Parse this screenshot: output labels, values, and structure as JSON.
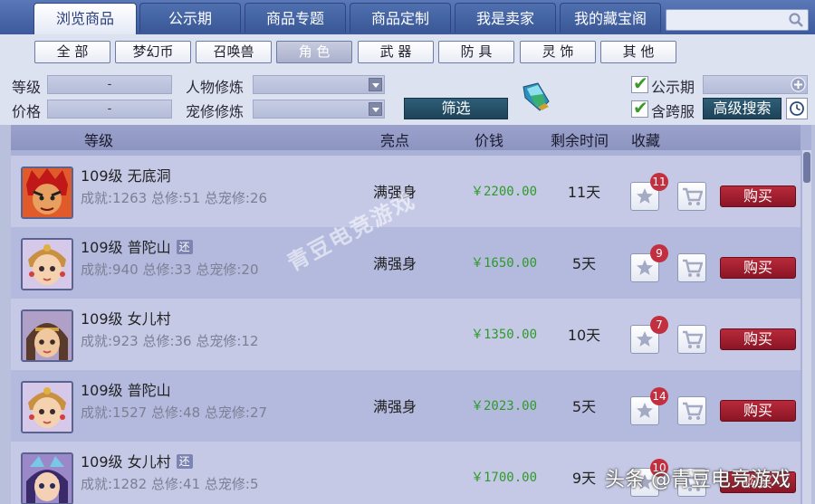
{
  "tabs": [
    "浏览商品",
    "公示期",
    "商品专题",
    "商品定制",
    "我是卖家",
    "我的藏宝阁"
  ],
  "categories": [
    "全 部",
    "梦幻币",
    "召唤兽",
    "角 色",
    "武 器",
    "防 具",
    "灵 饰",
    "其 他"
  ],
  "filter": {
    "level_label": "等级",
    "level_value": "-",
    "price_label": "价格",
    "price_value": "-",
    "char_cultivation_label": "人物修炼",
    "pet_cultivation_label": "宠修修炼",
    "filter_button": "筛选",
    "public_label": "公示期",
    "cross_server_label": "含跨服",
    "advanced_search_button": "高级搜索"
  },
  "columns": {
    "level": "等级",
    "highlight": "亮点",
    "price": "价钱",
    "remaining": "剩余时间",
    "favorite": "收藏"
  },
  "rows": [
    {
      "title": "109级  无底洞",
      "returned": "",
      "stats": "成就:1263 总修:51 总宠修:26",
      "highlight": "满强身",
      "price": "￥2200.00",
      "time": "11天",
      "favs": "11",
      "buy": "购买"
    },
    {
      "title": "109级  普陀山",
      "returned": "还",
      "stats": "成就:940 总修:33 总宠修:20",
      "highlight": "满强身",
      "price": "￥1650.00",
      "time": "5天",
      "favs": "9",
      "buy": "购买"
    },
    {
      "title": "109级  女儿村",
      "returned": "",
      "stats": "成就:923 总修:36 总宠修:12",
      "highlight": "",
      "price": "￥1350.00",
      "time": "10天",
      "favs": "7",
      "buy": "购买"
    },
    {
      "title": "109级  普陀山",
      "returned": "",
      "stats": "成就:1527 总修:48 总宠修:27",
      "highlight": "满强身",
      "price": "￥2023.00",
      "time": "5天",
      "favs": "14",
      "buy": "购买"
    },
    {
      "title": "109级  女儿村",
      "returned": "还",
      "stats": "成就:1282 总修:41 总宠修:5",
      "highlight": "",
      "price": "￥1700.00",
      "time": "9天",
      "favs": "10",
      "buy": "购买"
    }
  ],
  "watermark": "青豆电竞游戏",
  "caption": "头条 @青豆电竞游戏",
  "colors": {
    "accent": "#3c5a9c",
    "buy": "#a01f30",
    "price": "#2f9a2a",
    "badge": "#c23040"
  }
}
